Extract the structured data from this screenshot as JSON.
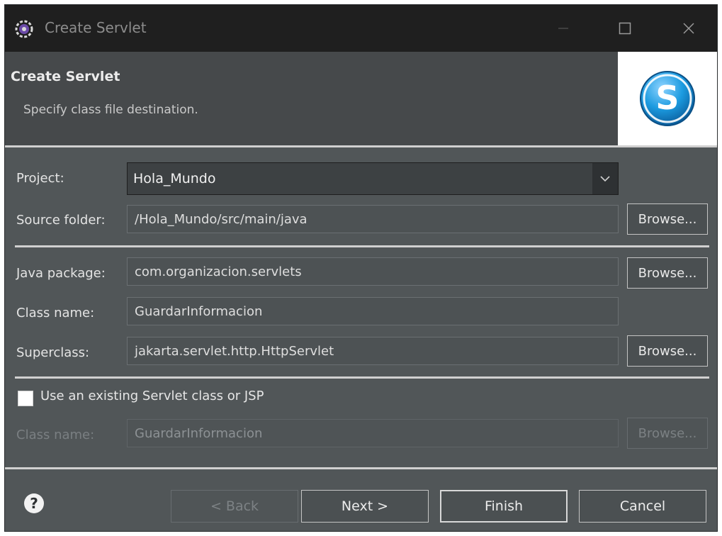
{
  "window": {
    "title": "Create Servlet",
    "icons": {
      "app": "gear-icon",
      "minimize": "minimize-icon",
      "maximize": "maximize-icon",
      "close": "close-icon"
    }
  },
  "banner": {
    "title": "Create Servlet",
    "subtitle": "Specify class file destination.",
    "image_icon": "servlet-s-icon"
  },
  "form": {
    "project": {
      "label": "Project:",
      "value": "Hola_Mundo"
    },
    "source_folder": {
      "label": "Source folder:",
      "value": "/Hola_Mundo/src/main/java",
      "browse": "Browse..."
    },
    "java_package": {
      "label": "Java package:",
      "value": "com.organizacion.servlets",
      "browse": "Browse..."
    },
    "class_name": {
      "label": "Class name:",
      "value": "GuardarInformacion"
    },
    "superclass": {
      "label": "Superclass:",
      "value": "jakarta.servlet.http.HttpServlet",
      "browse": "Browse..."
    },
    "use_existing": {
      "label": "Use an existing Servlet class or JSP",
      "checked": false
    },
    "existing_class": {
      "label": "Class name:",
      "value": "GuardarInformacion",
      "browse": "Browse..."
    }
  },
  "footer": {
    "help_icon": "help-icon",
    "back": "< Back",
    "next": "Next >",
    "finish": "Finish",
    "cancel": "Cancel"
  },
  "colors": {
    "dialog_bg": "#515658",
    "titlebar_bg": "#1f1f1f",
    "banner_bg": "#46494b",
    "separator": "#d0d0d0",
    "servlet_icon": "#1c9be0"
  }
}
